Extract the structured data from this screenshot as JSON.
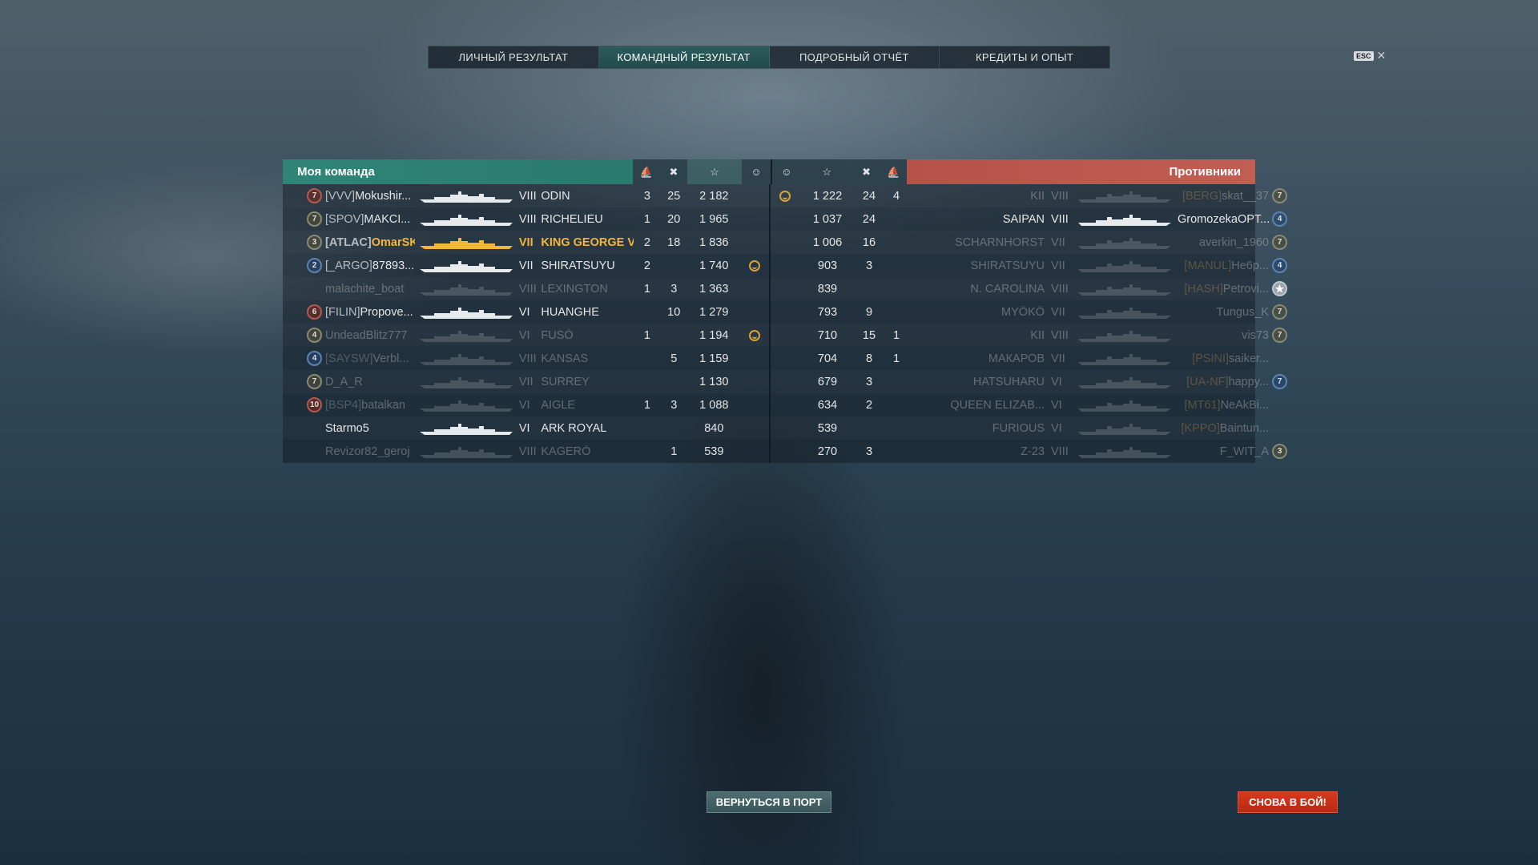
{
  "tabs": [
    "ЛИЧНЫЙ РЕЗУЛЬТАТ",
    "КОМАНДНЫЙ РЕЗУЛЬТАТ",
    "ПОДРОБНЫЙ ОТЧЁТ",
    "КРЕДИТЫ И ОПЫТ"
  ],
  "active_tab": 1,
  "esc_label": "ESC",
  "close_glyph": "✕",
  "my_team_label": "Моя команда",
  "enemy_team_label": "Противники",
  "header_icons": {
    "capture": "⛵",
    "kills": "✖",
    "xp": "☆",
    "ribbon": "☺"
  },
  "my_team": [
    {
      "rank": "7",
      "rank_style": "red",
      "clan": "[VVV]",
      "name": "Mokushir...",
      "tier": "VIII",
      "ship": "ODIN",
      "cap": "3",
      "kills": "25",
      "xp": "2 182",
      "ribbon": false,
      "dead": false,
      "me": false
    },
    {
      "rank": "7",
      "rank_style": "olive",
      "clan": "[SPOV]",
      "name": "MAKCI...",
      "tier": "VIII",
      "ship": "RICHELIEU",
      "cap": "1",
      "kills": "20",
      "xp": "1 965",
      "ribbon": false,
      "dead": false,
      "me": false
    },
    {
      "rank": "3",
      "rank_style": "olive",
      "clan": "[ATLAC]",
      "name": "OmarSK",
      "tier": "VII",
      "ship": "KING GEORGE V",
      "cap": "2",
      "kills": "18",
      "xp": "1 836",
      "ribbon": false,
      "dead": false,
      "me": true
    },
    {
      "rank": "2",
      "rank_style": "blue",
      "clan": "[_ARGO]",
      "name": "87893...",
      "tier": "VII",
      "ship": "SHIRATSUYU",
      "cap": "2",
      "kills": "",
      "xp": "1 740",
      "ribbon": true,
      "dead": false,
      "me": false
    },
    {
      "rank": "",
      "rank_style": "empty",
      "clan": "",
      "name": "malachite_boat",
      "tier": "VIII",
      "ship": "LEXINGTON",
      "cap": "1",
      "kills": "3",
      "xp": "1 363",
      "ribbon": false,
      "dead": true,
      "me": false
    },
    {
      "rank": "6",
      "rank_style": "red",
      "clan": "[FILIN]",
      "name": "Propove...",
      "tier": "VI",
      "ship": "HUANGHE",
      "cap": "",
      "kills": "10",
      "xp": "1 279",
      "ribbon": false,
      "dead": false,
      "me": false
    },
    {
      "rank": "4",
      "rank_style": "olive",
      "clan": "",
      "name": "UndeadBlitz777",
      "tier": "VI",
      "ship": "FUSŌ",
      "cap": "1",
      "kills": "",
      "xp": "1 194",
      "ribbon": true,
      "dead": true,
      "me": false
    },
    {
      "rank": "4",
      "rank_style": "blue",
      "clan": "[SAYSW]",
      "name": "Verbl...",
      "tier": "VIII",
      "ship": "KANSAS",
      "cap": "",
      "kills": "5",
      "xp": "1 159",
      "ribbon": false,
      "dead": true,
      "me": false
    },
    {
      "rank": "7",
      "rank_style": "olive",
      "clan": "",
      "name": "D_A_R",
      "tier": "VII",
      "ship": "SURREY",
      "cap": "",
      "kills": "",
      "xp": "1 130",
      "ribbon": false,
      "dead": true,
      "me": false
    },
    {
      "rank": "10",
      "rank_style": "red",
      "clan": "[BSP4]",
      "name": "batalkan",
      "tier": "VI",
      "ship": "AIGLE",
      "cap": "1",
      "kills": "3",
      "xp": "1 088",
      "ribbon": false,
      "dead": true,
      "me": false
    },
    {
      "rank": "",
      "rank_style": "empty",
      "clan": "",
      "name": "Starmo5",
      "tier": "VI",
      "ship": "ARK ROYAL",
      "cap": "",
      "kills": "",
      "xp": "840",
      "ribbon": false,
      "dead": false,
      "me": false
    },
    {
      "rank": "",
      "rank_style": "empty",
      "clan": "",
      "name": "Revizor82_geroj",
      "tier": "VIII",
      "ship": "KAGERŌ",
      "cap": "",
      "kills": "1",
      "xp": "539",
      "ribbon": false,
      "dead": true,
      "me": false
    }
  ],
  "enemy_team": [
    {
      "ribbon": true,
      "xp": "1 222",
      "kills": "24",
      "cap": "4",
      "ship": "KII",
      "tier": "VIII",
      "clan": "[BERG]",
      "name": "skat__37",
      "rank": "7",
      "rank_style": "olive",
      "dead": true
    },
    {
      "ribbon": false,
      "xp": "1 037",
      "kills": "24",
      "cap": "",
      "ship": "SAIPAN",
      "tier": "VIII",
      "clan": "",
      "name": "GromozekaOPT...",
      "rank": "4",
      "rank_style": "blue",
      "dead": false
    },
    {
      "ribbon": false,
      "xp": "1 006",
      "kills": "16",
      "cap": "",
      "ship": "SCHARNHORST",
      "tier": "VII",
      "clan": "",
      "name": "averkin_1960",
      "rank": "7",
      "rank_style": "olive",
      "dead": true
    },
    {
      "ribbon": false,
      "xp": "903",
      "kills": "3",
      "cap": "",
      "ship": "SHIRATSUYU",
      "tier": "VII",
      "clan": "[MANUL]",
      "name": "He6p...",
      "rank": "4",
      "rank_style": "blue",
      "dead": true
    },
    {
      "ribbon": false,
      "xp": "839",
      "kills": "",
      "cap": "",
      "ship": "N. CAROLINA",
      "tier": "VIII",
      "clan": "[HASH]",
      "name": "Petrovi...",
      "rank": "★",
      "rank_style": "star",
      "dead": true
    },
    {
      "ribbon": false,
      "xp": "793",
      "kills": "9",
      "cap": "",
      "ship": "MYŌKŌ",
      "tier": "VII",
      "clan": "",
      "name": "Tungus_K",
      "rank": "7",
      "rank_style": "olive",
      "dead": true
    },
    {
      "ribbon": false,
      "xp": "710",
      "kills": "15",
      "cap": "1",
      "ship": "KII",
      "tier": "VIII",
      "clan": "",
      "name": "vis73",
      "rank": "7",
      "rank_style": "olive",
      "dead": true
    },
    {
      "ribbon": false,
      "xp": "704",
      "kills": "8",
      "cap": "1",
      "ship": "МАКАРОВ",
      "tier": "VII",
      "clan": "[PSINI]",
      "name": "saiker...",
      "rank": "",
      "rank_style": "empty",
      "dead": true
    },
    {
      "ribbon": false,
      "xp": "679",
      "kills": "3",
      "cap": "",
      "ship": "HATSUHARU",
      "tier": "VI",
      "clan": "[UA-NF]",
      "name": "happy...",
      "rank": "7",
      "rank_style": "blue",
      "dead": true
    },
    {
      "ribbon": false,
      "xp": "634",
      "kills": "2",
      "cap": "",
      "ship": "QUEEN ELIZAB...",
      "tier": "VI",
      "clan": "[MT61]",
      "name": "NeAkBi...",
      "rank": "",
      "rank_style": "empty",
      "dead": true
    },
    {
      "ribbon": false,
      "xp": "539",
      "kills": "",
      "cap": "",
      "ship": "FURIOUS",
      "tier": "VI",
      "clan": "[KPPO]",
      "name": "Baintun...",
      "rank": "",
      "rank_style": "empty",
      "dead": true
    },
    {
      "ribbon": false,
      "xp": "270",
      "kills": "3",
      "cap": "",
      "ship": "Z-23",
      "tier": "VIII",
      "clan": "",
      "name": "F_WIT_A",
      "rank": "3",
      "rank_style": "olive",
      "dead": true
    }
  ],
  "btn_port": "ВЕРНУТЬСЯ В ПОРТ",
  "btn_battle": "СНОВА В БОЙ!",
  "colors": {
    "my_team": "#2f8577",
    "enemy_team": "#c25d52",
    "self_highlight": "#f2b63a",
    "battle_button": "#d63a1e"
  }
}
